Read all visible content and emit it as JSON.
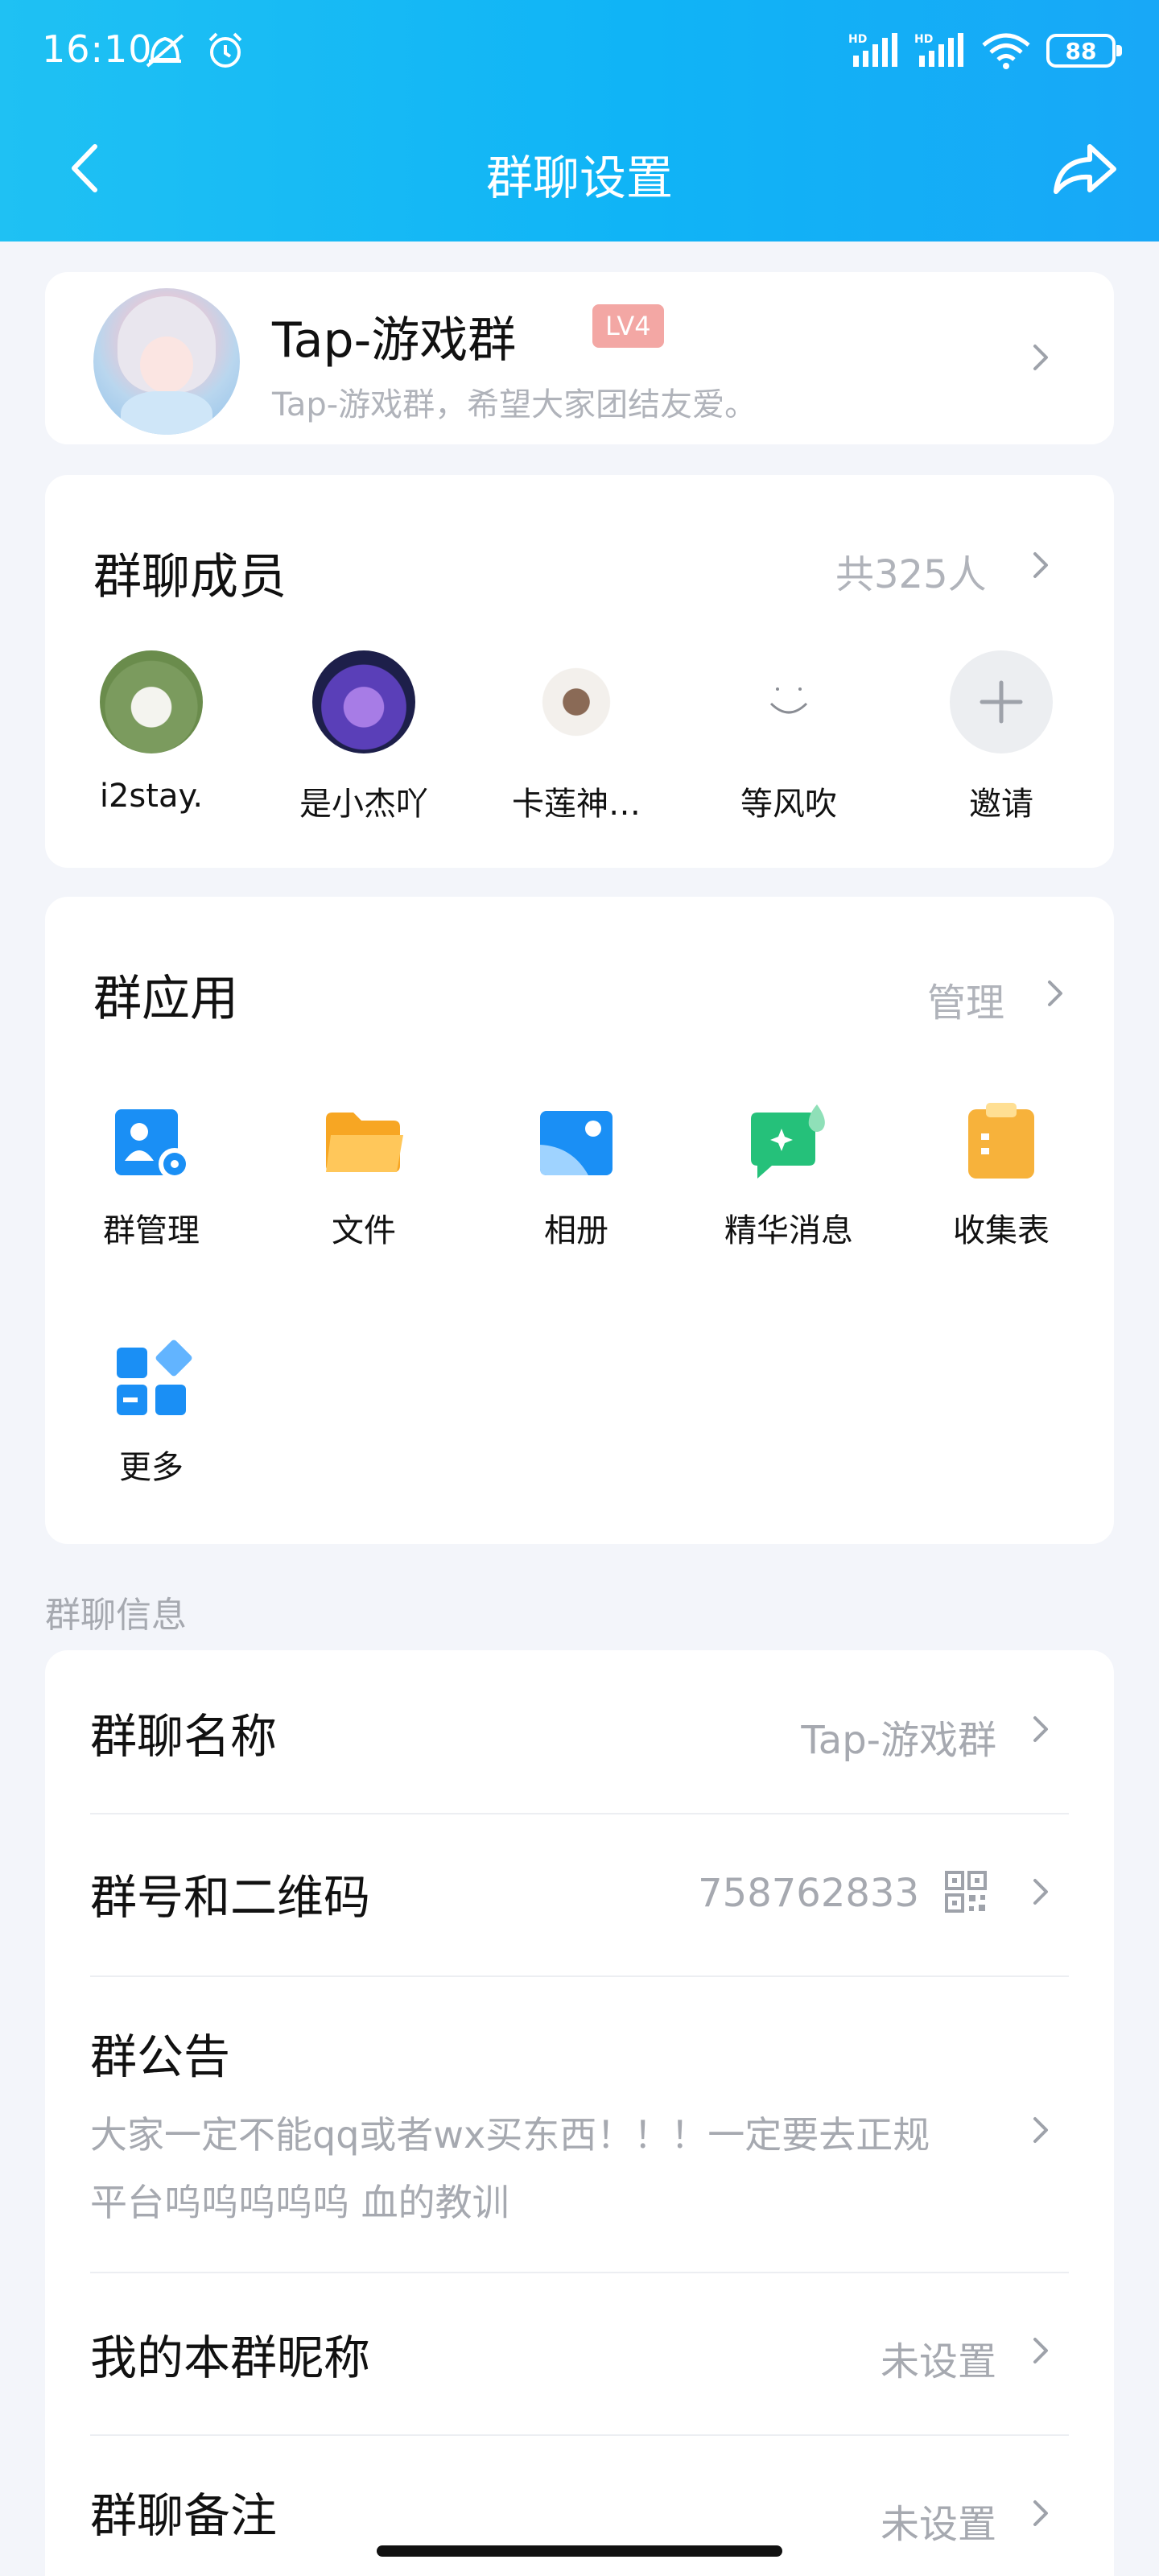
{
  "status_bar": {
    "time": "16:10",
    "battery": "88",
    "icons": [
      "mute-alarm-icon",
      "alarm-icon",
      "signal-hd-icon",
      "signal-hd-icon",
      "wifi-icon"
    ]
  },
  "nav": {
    "title": "群聊设置"
  },
  "group": {
    "name": "Tap-游戏群",
    "level": "LV4",
    "description": "Tap-游戏群，希望大家团结友爱。"
  },
  "members": {
    "title": "群聊成员",
    "count": "共325人",
    "list": [
      {
        "name": "i2stay."
      },
      {
        "name": "是小杰吖"
      },
      {
        "name": "卡莲神…"
      },
      {
        "name": "等风吹"
      }
    ],
    "invite": "邀请"
  },
  "apps": {
    "title": "群应用",
    "manage": "管理",
    "list": [
      {
        "label": "群管理",
        "icon": "group-manage-icon"
      },
      {
        "label": "文件",
        "icon": "folder-icon"
      },
      {
        "label": "相册",
        "icon": "album-icon"
      },
      {
        "label": "精华消息",
        "icon": "essence-message-icon"
      },
      {
        "label": "收集表",
        "icon": "clipboard-icon"
      },
      {
        "label": "更多",
        "icon": "more-grid-icon"
      }
    ]
  },
  "info": {
    "section_label": "群聊信息",
    "group_name_label": "群聊名称",
    "group_name_value": "Tap-游戏群",
    "group_number_label": "群号和二维码",
    "group_number_value": "758762833",
    "announcement_label": "群公告",
    "announcement_line1": "大家一定不能qq或者wx买东西！！！一定要去正规",
    "announcement_line2": "平台呜呜呜呜呜 血的教训",
    "nickname_label": "我的本群昵称",
    "nickname_value": "未设置",
    "remark_label": "群聊备注",
    "remark_value": "未设置"
  },
  "colors": {
    "header_gradient_start": "#1fc1f3",
    "header_gradient_end": "#18a8f7",
    "page_background": "#f3f5fa",
    "level_badge": "#f3a7a4",
    "accent_blue": "#1a8ff5"
  }
}
